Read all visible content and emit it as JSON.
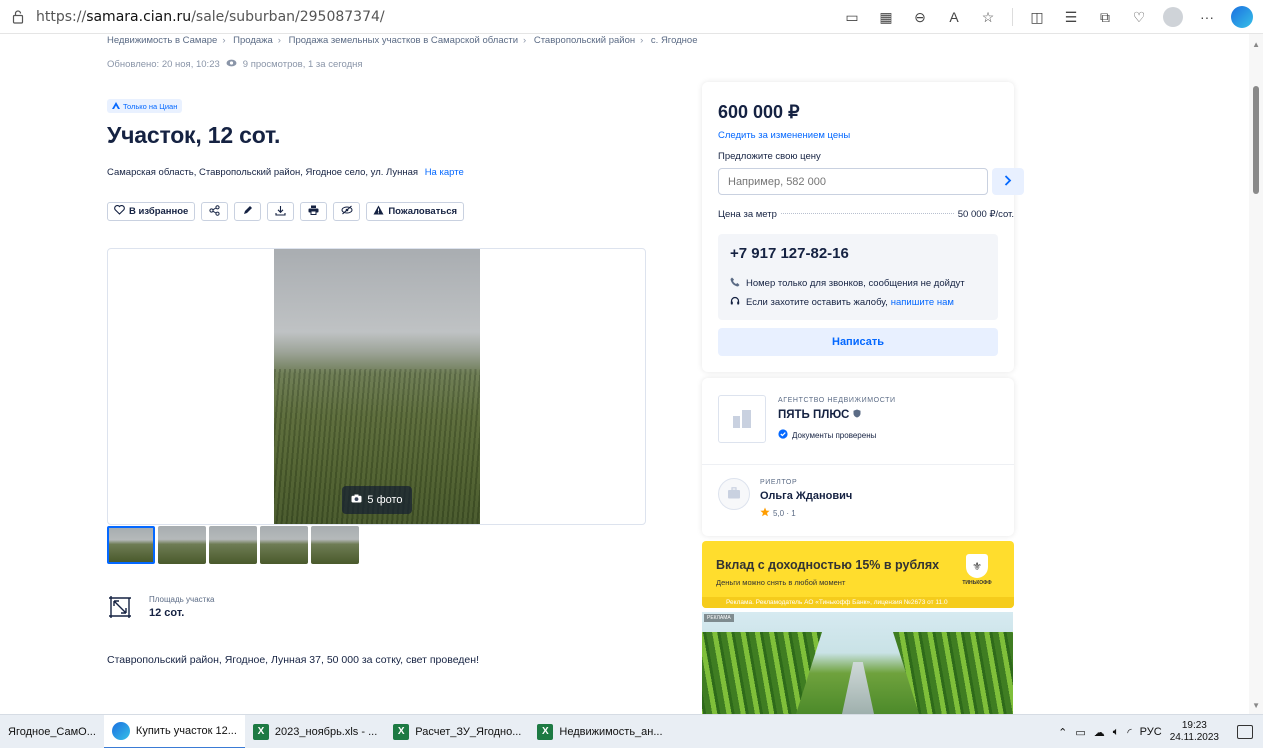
{
  "browser": {
    "url_prefix": "https://",
    "url_domain": "samara.cian.ru",
    "url_path": "/sale/suburban/295087374/"
  },
  "breadcrumbs": [
    "Недвижимость в Самаре",
    "Продажа",
    "Продажа земельных участков в Самарской области",
    "Ставропольский район",
    "с. Ягодное"
  ],
  "meta": {
    "updated": "Обновлено: 20 ноя, 10:23",
    "views": "9 просмотров, 1 за сегодня"
  },
  "badge": "Только на Циан",
  "title": "Участок, 12 сот.",
  "address": "Самарская область, Ставропольский район, Ягодное село, ул. Лунная",
  "map_link": "На карте",
  "actions": {
    "favorite": "В избранное",
    "complain": "Пожаловаться"
  },
  "gallery": {
    "photo_count": "5 фото",
    "thumbnails": 5
  },
  "area": {
    "label": "Площадь участка",
    "value": "12 сот."
  },
  "description": "Ставропольский район, Ягодное, Лунная 37, 50 000 за сотку, свет проведен!",
  "price_card": {
    "price": "600 000 ₽",
    "follow_price": "Следить за изменением цены",
    "suggest_label": "Предложите свою цену",
    "suggest_placeholder": "Например, 582 000",
    "per_meter_label": "Цена за метр",
    "per_meter_value": "50 000 ₽/сот.",
    "phone": "+7 917 127-82-16",
    "phone_note": "Номер только для звонков, сообщения не дойдут",
    "complaint_note": "Если захотите оставить жалобу,",
    "complaint_link": "напишите нам",
    "write_button": "Написать"
  },
  "agency": {
    "type": "АГЕНТСТВО НЕДВИЖИМОСТИ",
    "name": "ПЯТЬ ПЛЮС",
    "verified": "Документы проверены"
  },
  "realtor": {
    "type": "РИЕЛТОР",
    "name": "Ольга Жданович",
    "rating": "5,0 · 1"
  },
  "ad_bank": {
    "title": "Вклад с доходностью 15% в рублях",
    "subtitle": "Деньги можно снять в любой момент",
    "logo_text": "ТИНЬКОФФ",
    "legal": "Реклама. Рекламодатель АО «Тинькофф Банк», лицензия №2673 от 11.0"
  },
  "ad_green": {
    "tag": "РЕКЛАМА"
  },
  "taskbar": {
    "items": [
      "Ягодное_СамО...",
      "Купить участок 12...",
      "2023_ноябрь.xls - ...",
      "Расчет_ЗУ_Ягодно...",
      "Недвижимость_ан..."
    ],
    "lang": "РУС",
    "time": "19:23",
    "date": "24.11.2023"
  },
  "colors": {
    "accent": "#0468ff",
    "text": "#152242",
    "ad_yellow": "#ffdd2d"
  }
}
